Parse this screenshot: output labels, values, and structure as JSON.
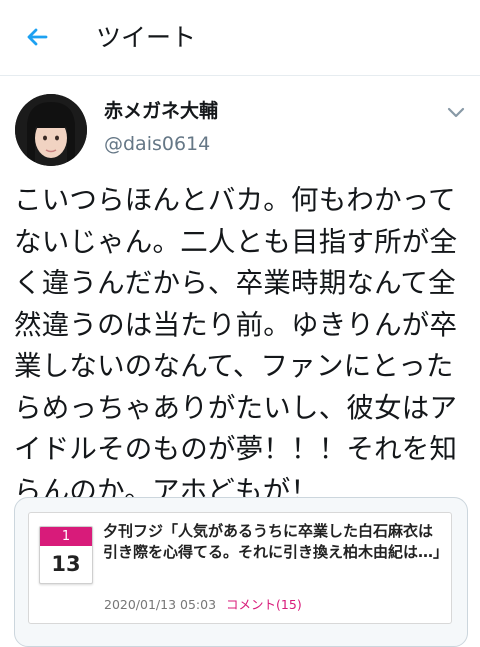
{
  "header": {
    "title": "ツイート"
  },
  "tweet": {
    "author_name": "赤メガネ大輔",
    "author_handle": "@dais0614",
    "text": "こいつらほんとバカ。何もわかってないじゃん。二人とも目指す所が全く違うんだから、卒業時期なんて全然違うのは当たり前。ゆきりんが卒業しないのなんて、ファンにとったらめっちゃありがたいし、彼女はアイドルそのものが夢！！！それを知らんのか。アホどもが！"
  },
  "card": {
    "month": "1",
    "day": "13",
    "headline": "夕刊フジ「人気があるうちに卒業した白石麻衣は引き際を心得てる。それに引き換え柏木由紀は…」",
    "timestamp": "2020/01/13 05:03",
    "comments": "コメント(15)"
  },
  "colors": {
    "accent": "#1da1f2",
    "calendar": "#d81b7a",
    "secondary_text": "#657786"
  }
}
